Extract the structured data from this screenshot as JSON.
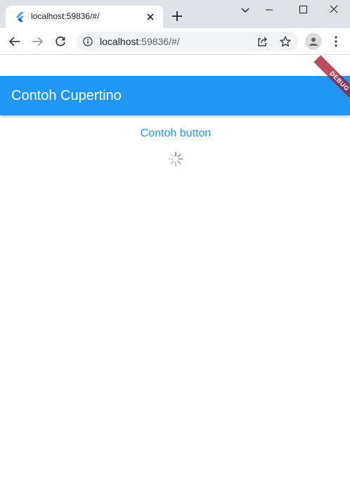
{
  "browser": {
    "tab_title": "localhost:59836/#/",
    "url_host": "localhost",
    "url_rest": ":59836/#/",
    "colors": {
      "tabstrip": "#dee1e6",
      "omnibox": "#f1f3f4"
    }
  },
  "app": {
    "appbar_title": "Contoh Cupertino",
    "button_label": "Contoh button",
    "debug_banner": "DEBUG",
    "colors": {
      "primary": "#2196f3",
      "background": "#ffffff"
    },
    "activity_indicator": "cupertino-activity-indicator"
  }
}
